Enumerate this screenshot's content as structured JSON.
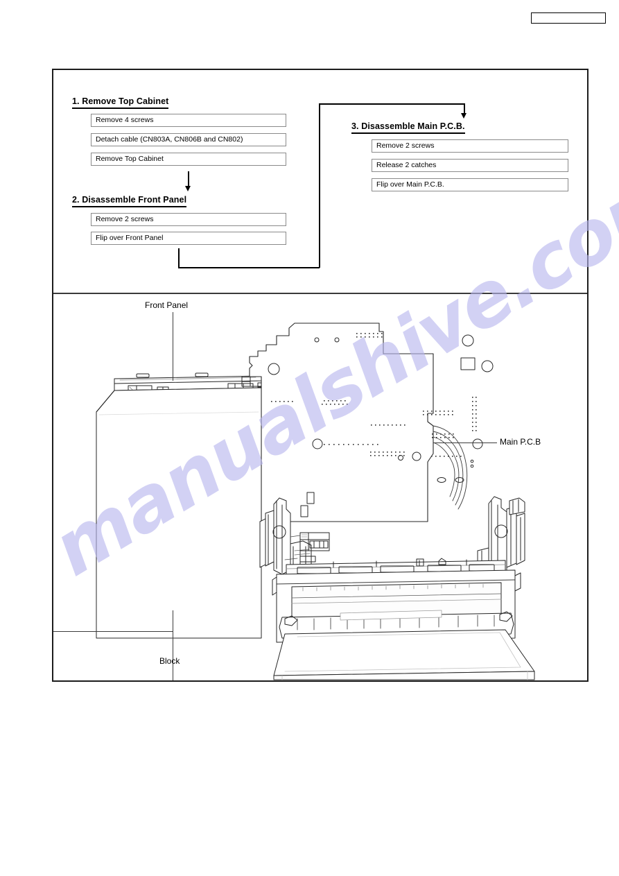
{
  "page": {
    "header_box_label": "",
    "watermark": "manualshive.com",
    "watermark_color": "#b8b6ee"
  },
  "flowchart": {
    "steps": [
      {
        "id": "step-1",
        "heading": "1. Remove Top Cabinet",
        "items": [
          "Remove 4 screws",
          "Detach cable (CN803A, CN806B and CN802)",
          "Remove Top Cabinet"
        ]
      },
      {
        "id": "step-2",
        "heading": "2. Disassemble Front Panel",
        "items": [
          "Remove 2 screws",
          "Flip over Front Panel"
        ]
      },
      {
        "id": "step-3",
        "heading": "3. Disassemble Main P.C.B.",
        "items": [
          "Remove 2 screws",
          "Release 2 catches",
          "Flip over Main P.C.B."
        ]
      }
    ]
  },
  "drawing": {
    "callouts": [
      {
        "id": "front-panel",
        "label": "Front Panel"
      },
      {
        "id": "main-pcb",
        "label": "Main P.C.B"
      },
      {
        "id": "block",
        "label": "Block"
      }
    ]
  }
}
